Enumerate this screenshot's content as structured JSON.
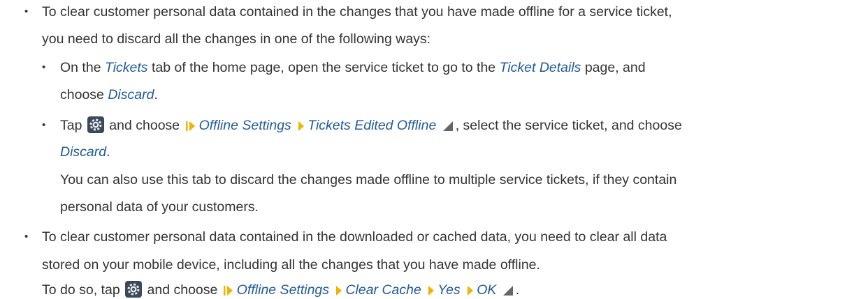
{
  "bullet_char": "•",
  "item1": {
    "line1": "To clear customer personal data contained in the changes that you have made offline for a service ticket,",
    "line2": "you need to discard all the changes in one of the following ways:"
  },
  "sub1": {
    "line1_a": "On the ",
    "tickets": "Tickets",
    "line1_b": " tab of the home page, open the service ticket to go to the ",
    "ticket_details": "Ticket Details",
    "line1_c": " page, and",
    "line2_a": "choose ",
    "discard": "Discard",
    "line2_b": "."
  },
  "sub2": {
    "tap": "Tap",
    "and_choose": "and choose",
    "offline_settings": "Offline Settings",
    "tickets_edited_offline": "Tickets Edited Offline",
    "after_path": ", select the service ticket, and choose",
    "discard": "Discard",
    "period": ".",
    "note_line1": "You can also use this tab to discard the changes made offline to multiple service tickets, if they contain",
    "note_line2": "personal data of your customers."
  },
  "item2": {
    "line1": "To clear customer personal data contained in the downloaded or cached data, you need to clear all data",
    "line2": "stored on your mobile device, including all the changes that you have made offline.",
    "line3_a": "To do so, tap",
    "and_choose": "and choose",
    "offline_settings": "Offline Settings",
    "clear_cache": "Clear Cache",
    "yes": "Yes",
    "ok": "OK",
    "period": "."
  },
  "colors": {
    "text": "#333333",
    "ui_term": "#1f5a9c",
    "path_marker": "#f0b400",
    "gear_bg": "#3a4a5a"
  },
  "icons": {
    "settings": "gear-icon",
    "path_start": "path-start-icon",
    "path_separator": "chevron-right-icon",
    "path_end": "path-end-icon"
  }
}
